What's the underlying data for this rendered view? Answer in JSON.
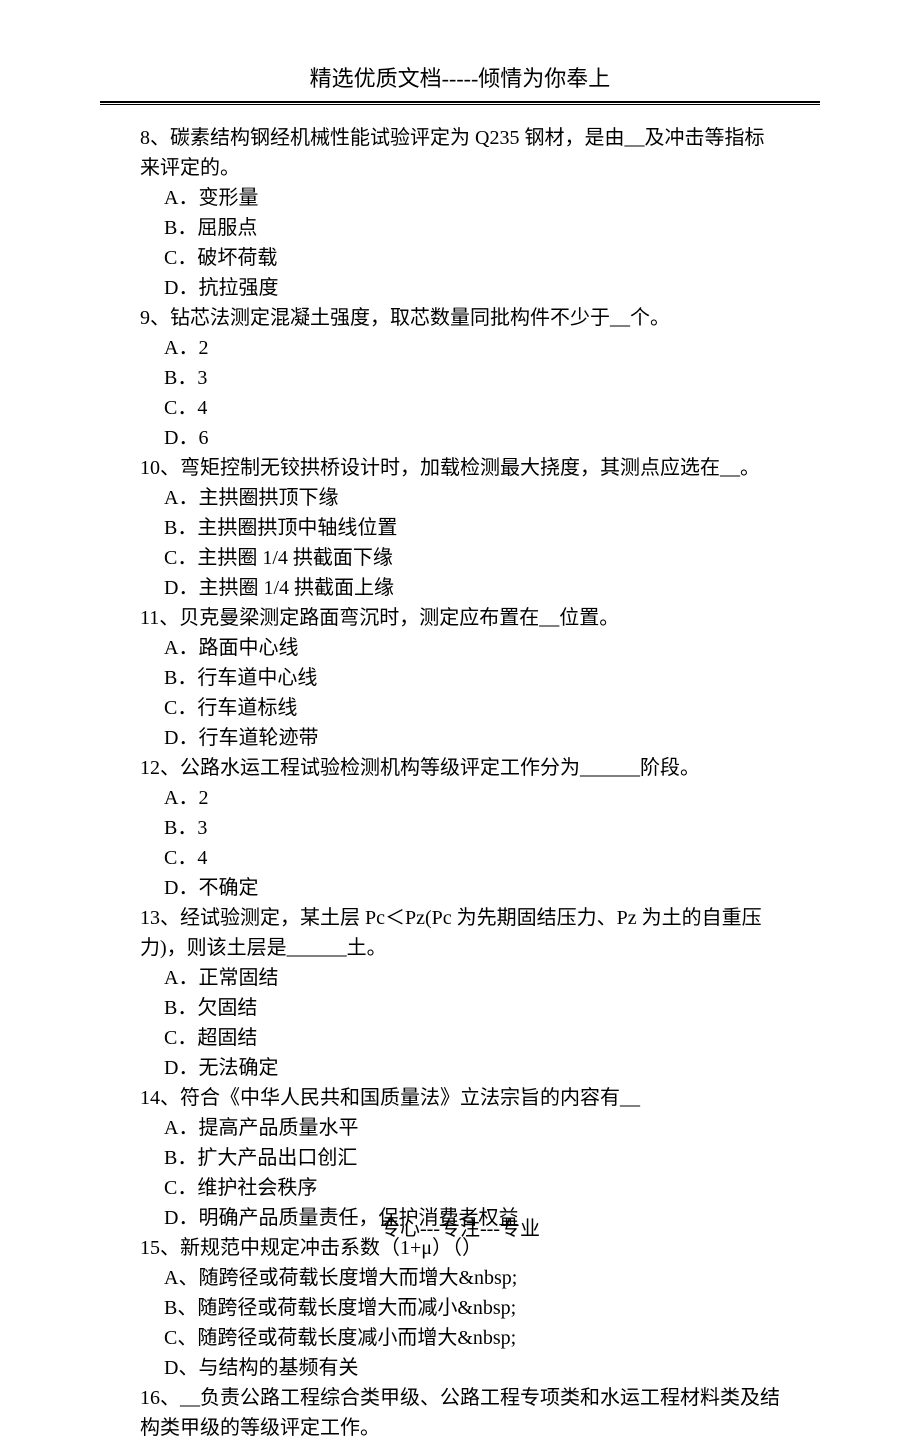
{
  "header": {
    "title": "精选优质文档-----倾情为你奉上"
  },
  "questions": [
    {
      "text": "8、碳素结构钢经机械性能试验评定为 Q235 钢材，是由__及冲击等指标来评定的。",
      "options": [
        "A．变形量",
        "B．屈服点",
        "C．破坏荷载",
        "D．抗拉强度"
      ]
    },
    {
      "text": "9、钻芯法测定混凝土强度，取芯数量同批构件不少于__个。",
      "options": [
        "A．2",
        "B．3",
        "C．4",
        "D．6"
      ]
    },
    {
      "text": "10、弯矩控制无铰拱桥设计时，加载检测最大挠度，其测点应选在__。",
      "options": [
        "A．主拱圈拱顶下缘",
        "B．主拱圈拱顶中轴线位置",
        "C．主拱圈 1/4 拱截面下缘",
        "D．主拱圈 1/4 拱截面上缘"
      ]
    },
    {
      "text": "11、贝克曼梁测定路面弯沉时，测定应布置在__位置。",
      "options": [
        "A．路面中心线",
        "B．行车道中心线",
        "C．行车道标线",
        "D．行车道轮迹带"
      ]
    },
    {
      "text": "12、公路水运工程试验检测机构等级评定工作分为______阶段。",
      "options": [
        "A．2",
        "B．3",
        "C．4",
        "D．不确定"
      ]
    },
    {
      "text": "13、经试验测定，某土层 Pc＜Pz(Pc 为先期固结压力、Pz 为土的自重压力)，则该土层是______土。",
      "options": [
        "A．正常固结",
        "B．欠固结",
        "C．超固结",
        "D．无法确定"
      ]
    },
    {
      "text": "14、符合《中华人民共和国质量法》立法宗旨的内容有__",
      "options": [
        "A．提高产品质量水平",
        "B．扩大产品出口创汇",
        "C．维护社会秩序",
        "D．明确产品质量责任，保护消费者权益"
      ]
    },
    {
      "text": "15、新规范中规定冲击系数（1+μ）（）",
      "options": [
        "A、随跨径或荷载长度增大而增大&nbsp;",
        "B、随跨径或荷载长度增大而减小&nbsp;",
        "C、随跨径或荷载长度减小而增大&nbsp;",
        "D、与结构的基频有关"
      ]
    },
    {
      "text": "16、__负责公路工程综合类甲级、公路工程专项类和水运工程材料类及结构类甲级的等级评定工作。",
      "options": []
    }
  ],
  "footer": {
    "text": "专心---专注---专业"
  }
}
